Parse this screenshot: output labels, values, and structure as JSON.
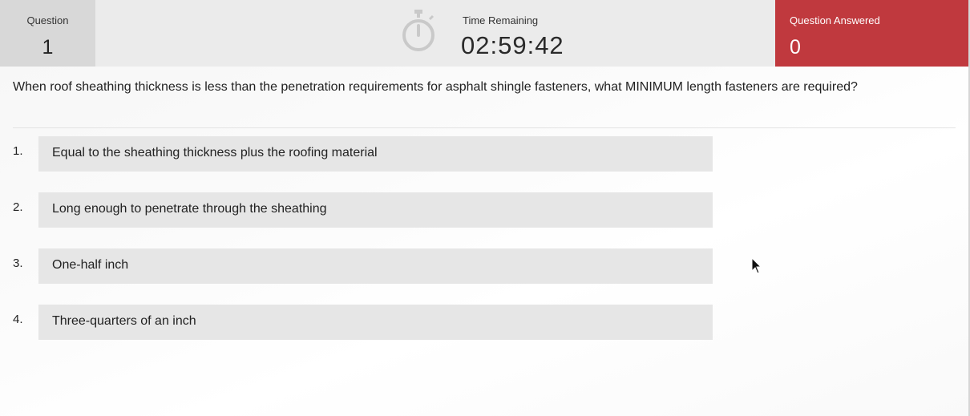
{
  "header": {
    "question_label": "Question",
    "question_number": "1",
    "timer_icon": "stopwatch-icon",
    "time_label": "Time Remaining",
    "time_value": "02:59:42",
    "answered_label": "Question Answered",
    "answered_value": "0"
  },
  "question": {
    "text": "When roof sheathing thickness is less than the penetration requirements for asphalt shingle fasteners, what MINIMUM length fasteners are required?"
  },
  "options": [
    {
      "number": "1.",
      "label": "Equal to the sheathing thickness plus the roofing material"
    },
    {
      "number": "2.",
      "label": "Long enough to penetrate through the sheathing"
    },
    {
      "number": "3.",
      "label": "One-half inch"
    },
    {
      "number": "4.",
      "label": "Three-quarters of an inch"
    }
  ],
  "colors": {
    "answered_bg": "#c0393e",
    "header_bg": "#ebebeb",
    "question_box_bg": "#d8d8d8",
    "option_bg": "#e6e6e6"
  },
  "cursor_icon": "mouse-pointer-icon"
}
